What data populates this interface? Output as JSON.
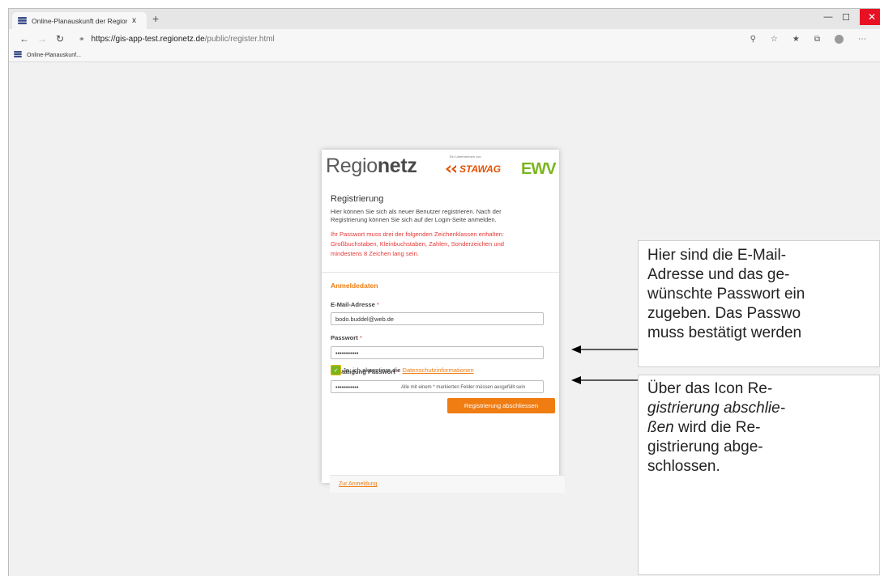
{
  "browser": {
    "tab_title": "Online-Planauskunft der Regione",
    "tab_close": "x",
    "new_tab": "+",
    "url_host": "https://gis-app-test.regionetz.de",
    "url_path": "/public/register.html",
    "bookmark_label": "Online-Planauskunf..."
  },
  "logo": {
    "brand_light": "Regio",
    "brand_bold": "netz",
    "subline": "Ein Unternehmen von",
    "partner1": "STAWAG",
    "partner2": "EWV",
    "colors": {
      "stawag": "#e35205",
      "ewv": "#7ab51d"
    }
  },
  "form": {
    "title": "Registrierung",
    "intro_line1": "Hier können Sie sich als neuer Benutzer registrieren. Nach der",
    "intro_line2": "Registrierung können Sie sich auf der Login-Seite anmelden.",
    "warning_line1": "Ihr Passwort muss drei der folgenden Zeichenklassen enhalten:",
    "warning_line2": "Großbuchstaben, Kleinbuchstaben, Zahlen, Sonderzeichen und",
    "warning_line3": "mindestens 8 Zeichen lang sein.",
    "section": "Anmeldedaten",
    "email_label": "E-Mail-Adresse",
    "email_value": "bodo.buddel@web.de",
    "password_label": "Passwort",
    "password_value": "•••••••••••",
    "confirm_label": "Bestätigung Passwort",
    "confirm_value": "•••••••••••",
    "required_marker": "*",
    "consent_prefix": "Ja, ich akzeptiere die",
    "consent_link": "Datenschutzinformationen",
    "consent_checked": true,
    "required_note": "Alle mit einem * markierten Felder müssen ausgefüllt sein",
    "submit_label": "Registrierung abschliessen",
    "footer_link": "Zur Anmeldung",
    "accent_color": "#f07d12",
    "warning_color": "#e53935"
  },
  "callouts": {
    "c1": [
      "Hier sind die E-Mail-",
      "Adresse und das ge-",
      "wünschte Passwort ein",
      "zugeben. Das Passwo",
      "muss bestätigt werden"
    ],
    "c2_line1": "Über das Icon  Re-",
    "c2_line2": "gistrierung abschlie-",
    "c2_line3_italic": "ßen",
    "c2_line3_rest": "  wird die  Re-",
    "c2_line4": "gistrierung abge-",
    "c2_line5": "schlossen."
  }
}
